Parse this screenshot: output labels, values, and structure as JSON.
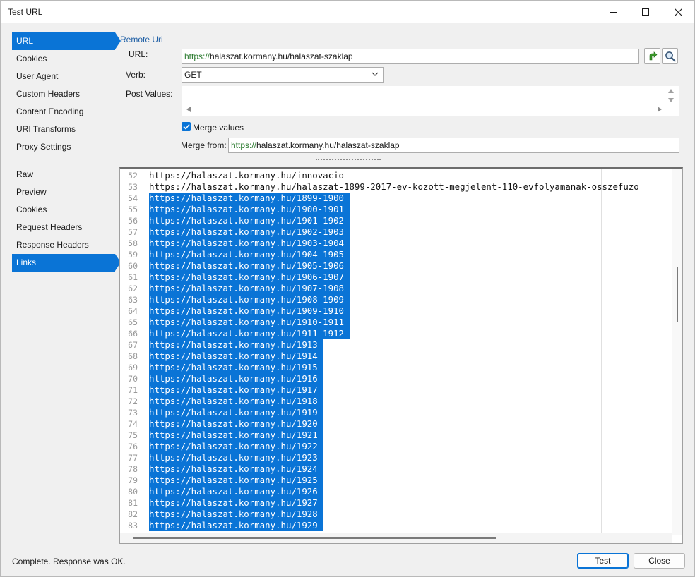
{
  "window": {
    "title": "Test URL"
  },
  "sidebar": {
    "request_items": [
      {
        "label": "URL",
        "active": true
      },
      {
        "label": "Cookies",
        "active": false
      },
      {
        "label": "User Agent",
        "active": false
      },
      {
        "label": "Custom Headers",
        "active": false
      },
      {
        "label": "Content Encoding",
        "active": false
      },
      {
        "label": "URI Transforms",
        "active": false
      },
      {
        "label": "Proxy Settings",
        "active": false
      }
    ],
    "response_items": [
      {
        "label": "Raw",
        "active": false
      },
      {
        "label": "Preview",
        "active": false
      },
      {
        "label": "Cookies",
        "active": false
      },
      {
        "label": "Request Headers",
        "active": false
      },
      {
        "label": "Response Headers",
        "active": false
      },
      {
        "label": "Links",
        "active": true
      }
    ]
  },
  "form": {
    "group_title": "Remote Uri",
    "url_label": "URL:",
    "url_scheme": "https://",
    "url_rest": "halaszat.kormany.hu/halaszat-szaklap",
    "verb_label": "Verb:",
    "verb_value": "GET",
    "post_label": "Post Values:",
    "post_value": "",
    "merge_checkbox_label": "Merge values",
    "merge_checked": true,
    "merge_from_label": "Merge from:",
    "merge_from_scheme": "https://",
    "merge_from_rest": "halaszat.kormany.hu/halaszat-szaklap",
    "splitter_glyph": "..................."
  },
  "editor": {
    "lines": [
      {
        "n": "52",
        "text": "https://halaszat.kormany.hu/innovacio",
        "selected": false
      },
      {
        "n": "53",
        "text": "https://halaszat.kormany.hu/halaszat-1899-2017-ev-kozott-megjelent-110-evfolyamanak-osszefuzo",
        "selected": false
      },
      {
        "n": "54",
        "text": "https://halaszat.kormany.hu/1899-1900",
        "selected": true
      },
      {
        "n": "55",
        "text": "https://halaszat.kormany.hu/1900-1901",
        "selected": true
      },
      {
        "n": "56",
        "text": "https://halaszat.kormany.hu/1901-1902",
        "selected": true
      },
      {
        "n": "57",
        "text": "https://halaszat.kormany.hu/1902-1903",
        "selected": true
      },
      {
        "n": "58",
        "text": "https://halaszat.kormany.hu/1903-1904",
        "selected": true
      },
      {
        "n": "59",
        "text": "https://halaszat.kormany.hu/1904-1905",
        "selected": true
      },
      {
        "n": "60",
        "text": "https://halaszat.kormany.hu/1905-1906",
        "selected": true
      },
      {
        "n": "61",
        "text": "https://halaszat.kormany.hu/1906-1907",
        "selected": true
      },
      {
        "n": "62",
        "text": "https://halaszat.kormany.hu/1907-1908",
        "selected": true
      },
      {
        "n": "63",
        "text": "https://halaszat.kormany.hu/1908-1909",
        "selected": true
      },
      {
        "n": "64",
        "text": "https://halaszat.kormany.hu/1909-1910",
        "selected": true
      },
      {
        "n": "65",
        "text": "https://halaszat.kormany.hu/1910-1911",
        "selected": true
      },
      {
        "n": "66",
        "text": "https://halaszat.kormany.hu/1911-1912",
        "selected": true
      },
      {
        "n": "67",
        "text": "https://halaszat.kormany.hu/1913",
        "selected": true
      },
      {
        "n": "68",
        "text": "https://halaszat.kormany.hu/1914",
        "selected": true
      },
      {
        "n": "69",
        "text": "https://halaszat.kormany.hu/1915",
        "selected": true
      },
      {
        "n": "70",
        "text": "https://halaszat.kormany.hu/1916",
        "selected": true
      },
      {
        "n": "71",
        "text": "https://halaszat.kormany.hu/1917",
        "selected": true
      },
      {
        "n": "72",
        "text": "https://halaszat.kormany.hu/1918",
        "selected": true
      },
      {
        "n": "73",
        "text": "https://halaszat.kormany.hu/1919",
        "selected": true
      },
      {
        "n": "74",
        "text": "https://halaszat.kormany.hu/1920",
        "selected": true
      },
      {
        "n": "75",
        "text": "https://halaszat.kormany.hu/1921",
        "selected": true
      },
      {
        "n": "76",
        "text": "https://halaszat.kormany.hu/1922",
        "selected": true
      },
      {
        "n": "77",
        "text": "https://halaszat.kormany.hu/1923",
        "selected": true
      },
      {
        "n": "78",
        "text": "https://halaszat.kormany.hu/1924",
        "selected": true
      },
      {
        "n": "79",
        "text": "https://halaszat.kormany.hu/1925",
        "selected": true
      },
      {
        "n": "80",
        "text": "https://halaszat.kormany.hu/1926",
        "selected": true
      },
      {
        "n": "81",
        "text": "https://halaszat.kormany.hu/1927",
        "selected": true
      },
      {
        "n": "82",
        "text": "https://halaszat.kormany.hu/1928",
        "selected": true
      },
      {
        "n": "83",
        "text": "https://halaszat.kormany.hu/1929",
        "selected": true
      }
    ]
  },
  "footer": {
    "status": "Complete. Response was OK.",
    "test_label": "Test",
    "close_label": "Close"
  },
  "icons": {
    "go": "green-arrow-icon",
    "search": "magnifier-icon",
    "minimize": "minimize-icon",
    "maximize": "maximize-icon",
    "close": "close-icon"
  },
  "colors": {
    "accent": "#0a74d6",
    "scheme": "#2e7d32",
    "group_title": "#1f5fa5"
  }
}
